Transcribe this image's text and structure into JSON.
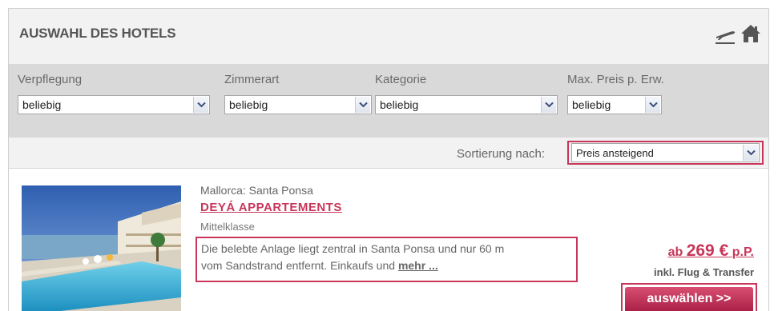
{
  "header": {
    "title": "AUSWAHL DES HOTELS",
    "icons": [
      "plane-icon",
      "home-icon"
    ]
  },
  "filters": [
    {
      "label": "Verpflegung",
      "value": "beliebig"
    },
    {
      "label": "Zimmerart",
      "value": "beliebig"
    },
    {
      "label": "Kategorie",
      "value": "beliebig"
    },
    {
      "label": "Max. Preis p. Erw.",
      "value": "beliebig"
    }
  ],
  "sort": {
    "label": "Sortierung nach:",
    "value": "Preis ansteigend"
  },
  "hotel": {
    "region": "Mallorca: Santa Ponsa",
    "name": "DEYÁ APPARTEMENTS",
    "category": "Mittelklasse",
    "description_line1": "Die belebte Anlage liegt zentral in Santa Ponsa und nur 60 m",
    "description_line2": "vom Sandstrand entfernt. Einkaufs und",
    "more_link": "mehr ...",
    "price_prefix": "ab",
    "price_value": "269 €",
    "price_suffix": "p.P.",
    "price_note": "inkl. Flug & Transfer",
    "select_button": "auswählen >>"
  },
  "colors": {
    "accent": "#c8365a",
    "header_bg": "#f2f2f2",
    "filter_bg": "#d9d9d9",
    "text_gray": "#666666"
  }
}
